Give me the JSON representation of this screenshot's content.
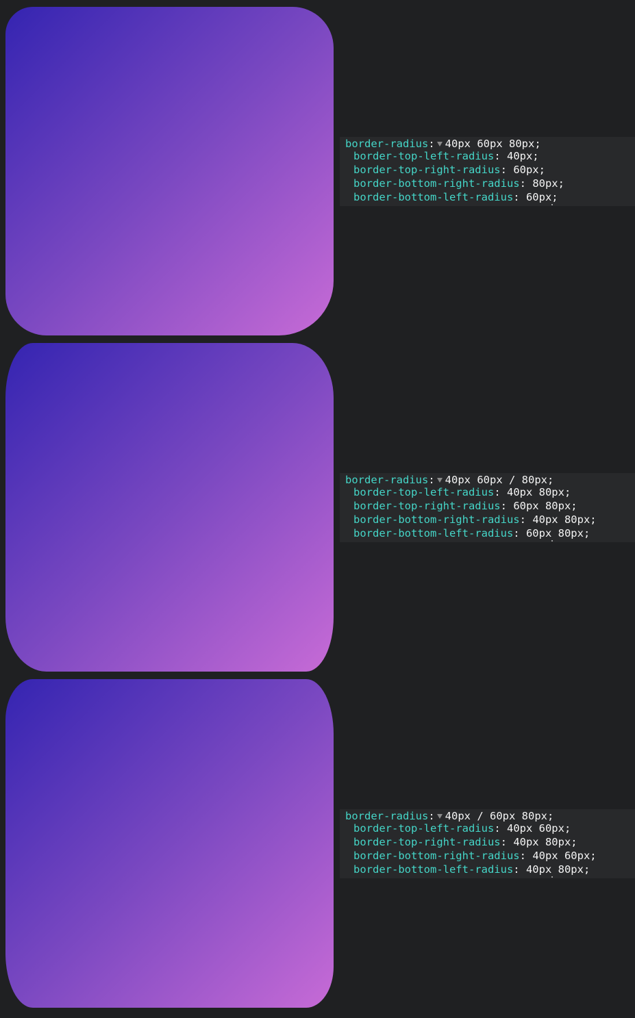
{
  "colors": {
    "background": "#1f2022",
    "panel": "#28292b",
    "property": "#45d6c8",
    "value": "#f4f4f4",
    "gradient_start": "#3424b1",
    "gradient_end": "#c76bd6"
  },
  "examples": [
    {
      "shorthand": {
        "property": "border-radius",
        "value": "40px 60px 80px;"
      },
      "longhands": [
        {
          "property": "border-top-left-radius",
          "value": "40px;"
        },
        {
          "property": "border-top-right-radius",
          "value": "60px;"
        },
        {
          "property": "border-bottom-right-radius",
          "value": "80px;"
        },
        {
          "property": "border-bottom-left-radius",
          "value": "60px;"
        }
      ]
    },
    {
      "shorthand": {
        "property": "border-radius",
        "value": "40px 60px / 80px;"
      },
      "longhands": [
        {
          "property": "border-top-left-radius",
          "value": "40px 80px;"
        },
        {
          "property": "border-top-right-radius",
          "value": "60px 80px;"
        },
        {
          "property": "border-bottom-right-radius",
          "value": "40px 80px;"
        },
        {
          "property": "border-bottom-left-radius",
          "value": "60px 80px;"
        }
      ]
    },
    {
      "shorthand": {
        "property": "border-radius",
        "value": "40px / 60px 80px;"
      },
      "longhands": [
        {
          "property": "border-top-left-radius",
          "value": "40px 60px;"
        },
        {
          "property": "border-top-right-radius",
          "value": "40px 80px;"
        },
        {
          "property": "border-bottom-right-radius",
          "value": "40px 60px;"
        },
        {
          "property": "border-bottom-left-radius",
          "value": "40px 80px;"
        }
      ]
    }
  ]
}
